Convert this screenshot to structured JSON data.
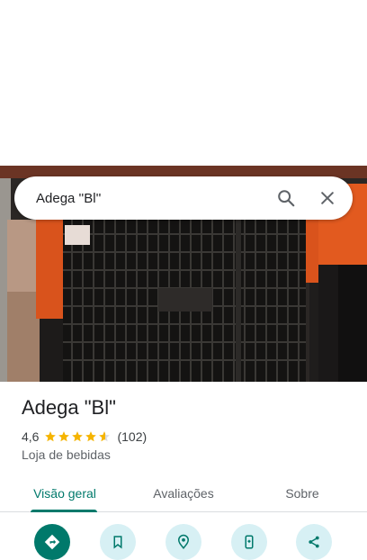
{
  "search": {
    "query": "Adega ''Bl''"
  },
  "place": {
    "name": "Adega \"Bl\"",
    "rating": "4,6",
    "rating_value": 4.6,
    "review_count": "(102)",
    "category": "Loja de bebidas"
  },
  "tabs": {
    "overview": "Visão geral",
    "reviews": "Avaliações",
    "about": "Sobre"
  },
  "colors": {
    "accent": "#00796b",
    "star": "#f5b400",
    "action_bg": "#d7f0f4"
  },
  "actions": [
    {
      "icon": "directions-icon"
    },
    {
      "icon": "bookmark-icon"
    },
    {
      "icon": "nearby-icon"
    },
    {
      "icon": "send-to-phone-icon"
    },
    {
      "icon": "share-icon"
    }
  ]
}
